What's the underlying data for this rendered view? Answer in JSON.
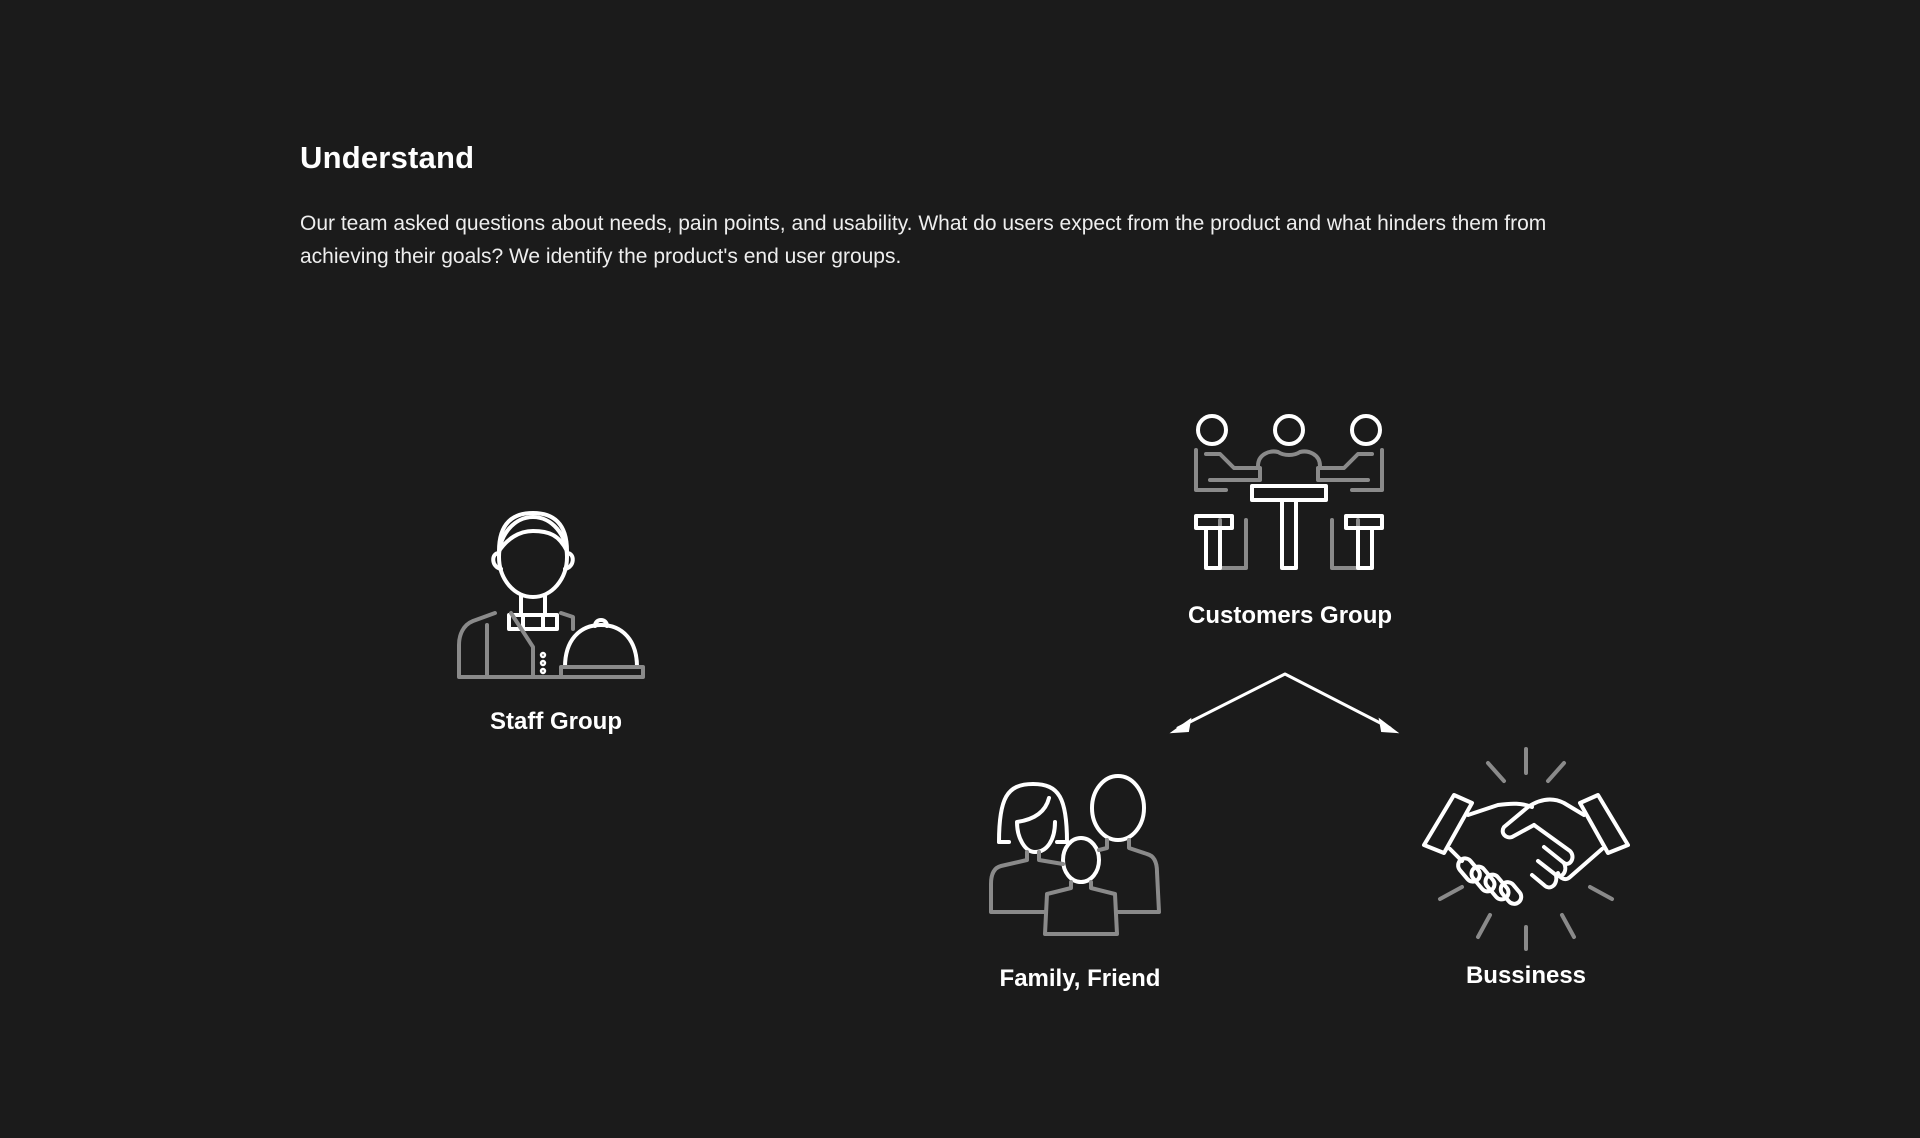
{
  "section": {
    "title": "Understand",
    "description": "Our team asked questions about needs, pain points, and usability. What do users expect from the product and what hinders them from achieving their goals? We identify the product's end user groups."
  },
  "groups": {
    "staff": {
      "label": "Staff Group",
      "icon": "waiter-icon"
    },
    "customers": {
      "label": "Customers Group",
      "icon": "dining-table-icon"
    },
    "family": {
      "label": "Family, Friend",
      "icon": "family-icon"
    },
    "business": {
      "label": "Bussiness",
      "icon": "handshake-icon"
    }
  },
  "colors": {
    "background": "#1b1b1b",
    "primary": "#ffffff",
    "secondary": "#8a8a8a"
  }
}
